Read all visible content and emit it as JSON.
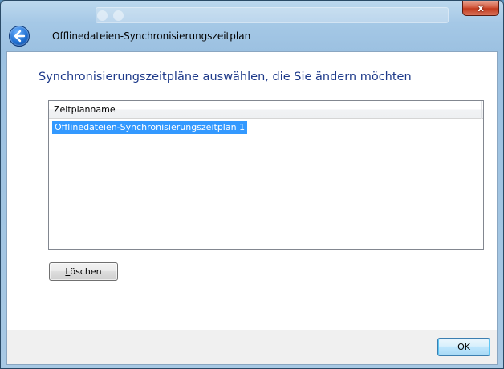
{
  "window": {
    "title": "Offlinedateien-Synchronisierungszeitplan",
    "close_label": "x"
  },
  "icons": {
    "back": "back-arrow-icon",
    "close": "close-icon"
  },
  "main": {
    "instruction": "Synchronisierungszeitpläne auswählen, die Sie ändern möchten",
    "list": {
      "column_header": "Zeitplanname",
      "rows": [
        {
          "label": "Offlinedateien-Synchronisierungszeitplan 1",
          "selected": true
        }
      ]
    },
    "delete_button": {
      "accel": "L",
      "rest": "öschen"
    }
  },
  "footer": {
    "ok_label": "OK"
  },
  "colors": {
    "instruction_text": "#1e3a8a",
    "selection": "#3399ff",
    "window_frame": "#a5c8e6"
  }
}
